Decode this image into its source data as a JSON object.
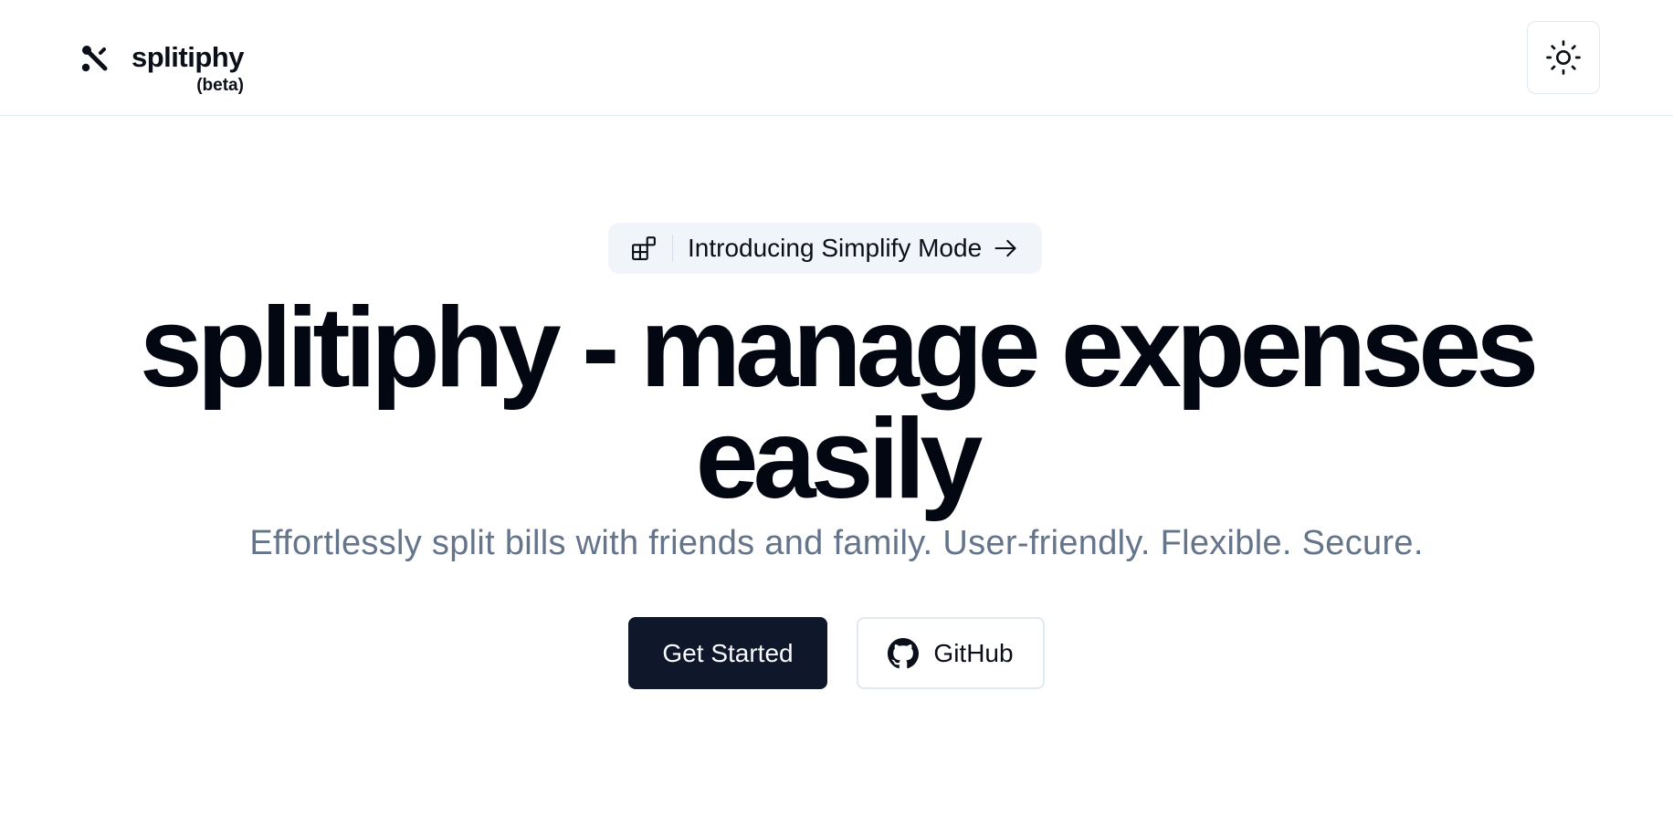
{
  "header": {
    "brand_name": "splitiphy",
    "brand_tag": "(beta)",
    "brand_icon": "split-icon",
    "theme_toggle_icon": "sun-icon"
  },
  "announcement": {
    "icon": "layout-blocks-icon",
    "label": "Introducing Simplify Mode",
    "arrow_icon": "arrow-right-icon"
  },
  "hero": {
    "title_line1": "splitiphy - manage expenses",
    "title_line2": "easily",
    "subtitle": "Effortlessly split bills with friends and family. User-friendly. Flexible. Secure."
  },
  "actions": {
    "primary_label": "Get Started",
    "secondary_label": "GitHub",
    "secondary_icon": "github-icon"
  },
  "colors": {
    "primary_button": "#0f172a",
    "subtitle_text": "#64748b",
    "pill_background": "#f1f5f9",
    "border": "#e2e8f0"
  }
}
